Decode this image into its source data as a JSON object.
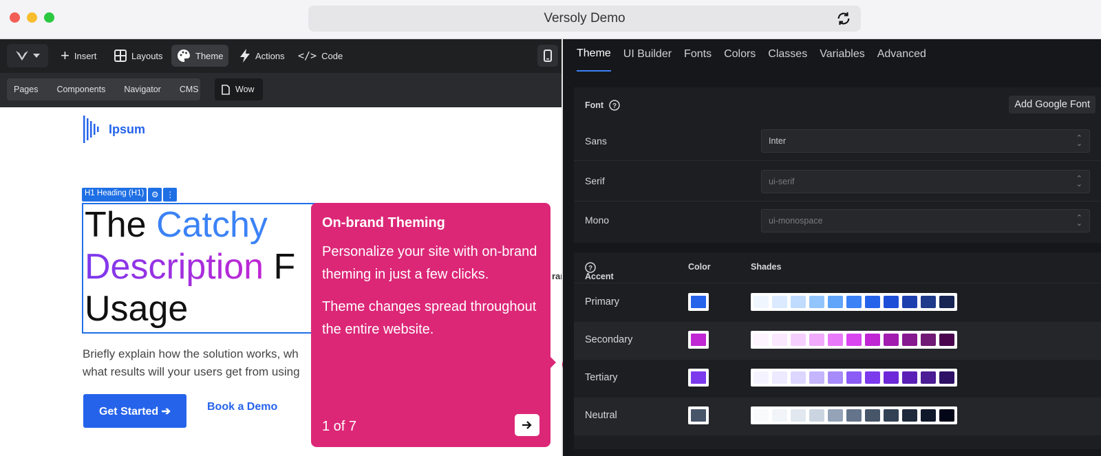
{
  "browser": {
    "title": "Versoly Demo"
  },
  "toolbar": {
    "items": [
      {
        "label": "Insert",
        "icon": "plus-icon"
      },
      {
        "label": "Layouts",
        "icon": "layout-icon"
      },
      {
        "label": "Theme",
        "icon": "palette-icon",
        "active": true
      },
      {
        "label": "Actions",
        "icon": "bolt-icon"
      },
      {
        "label": "Code",
        "icon": "code-icon"
      }
    ]
  },
  "subtoolbar": {
    "tabs": [
      "Pages",
      "Components",
      "Navigator",
      "CMS"
    ],
    "current_page": "Wow"
  },
  "canvas": {
    "brand": "Ipsum",
    "heading_label": "H1 Heading (H1)",
    "heading_part1": "The ",
    "heading_part2": "Catchy",
    "heading_part3": "Description",
    "heading_part4": " F",
    "heading_part5": "Usage",
    "lead_line1": "Briefly explain how the solution works, wh",
    "lead_line2": "what results will your users get from using",
    "cta_label": "Get Started ➔",
    "demo_label": "Book a Demo",
    "side_fragment": "ran"
  },
  "tour": {
    "title": "On-brand Theming",
    "body1": "Personalize your site with on-brand theming in just a few clicks.",
    "body2": "Theme changes spread throughout the entire website.",
    "step": "1 of 7"
  },
  "panel": {
    "tabs": [
      "Theme",
      "UI Builder",
      "Fonts",
      "Colors",
      "Classes",
      "Variables",
      "Advanced"
    ],
    "font": {
      "heading": "Font",
      "add_button": "Add Google Font",
      "rows": [
        {
          "label": "Sans",
          "value": "Inter"
        },
        {
          "label": "Serif",
          "value": "ui-serif"
        },
        {
          "label": "Mono",
          "value": "ui-monospace"
        }
      ]
    },
    "accent": {
      "heading": "Accent",
      "color_heading": "Color",
      "shades_heading": "Shades",
      "rows": [
        {
          "name": "Primary",
          "color": "#2563eb",
          "shades": [
            "#eff6ff",
            "#dbeafe",
            "#bfdbfe",
            "#93c5fd",
            "#60a5fa",
            "#3b82f6",
            "#2563eb",
            "#1d4ed8",
            "#1e40af",
            "#1e3a8a",
            "#172554"
          ]
        },
        {
          "name": "Secondary",
          "color": "#c026d3",
          "shades": [
            "#fdf4ff",
            "#fae8ff",
            "#f5d0fe",
            "#f0abfc",
            "#e879f9",
            "#d946ef",
            "#c026d3",
            "#a21caf",
            "#86198f",
            "#701a75",
            "#4a044e"
          ]
        },
        {
          "name": "Tertiary",
          "color": "#7c3aed",
          "shades": [
            "#f5f3ff",
            "#ede9fe",
            "#ddd6fe",
            "#c4b5fd",
            "#a78bfa",
            "#8b5cf6",
            "#7c3aed",
            "#6d28d9",
            "#5b21b6",
            "#4c1d95",
            "#2e1065"
          ]
        },
        {
          "name": "Neutral",
          "color": "#475569",
          "shades": [
            "#f8fafc",
            "#f1f5f9",
            "#e2e8f0",
            "#cbd5e1",
            "#94a3b8",
            "#64748b",
            "#475569",
            "#334155",
            "#1e293b",
            "#0f172a",
            "#020617"
          ]
        }
      ]
    }
  }
}
